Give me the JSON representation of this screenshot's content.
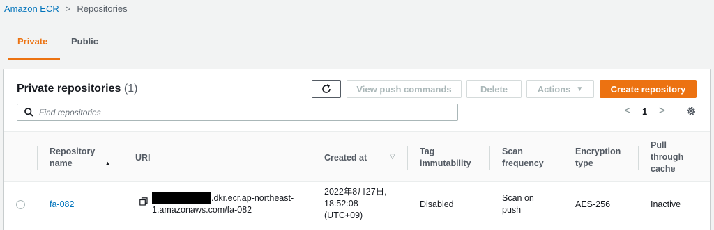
{
  "breadcrumb": {
    "root": "Amazon ECR",
    "separator": ">",
    "current": "Repositories"
  },
  "tabs": [
    {
      "label": "Private",
      "active": true
    },
    {
      "label": "Public",
      "active": false
    }
  ],
  "panel": {
    "title": "Private repositories",
    "count": "(1)"
  },
  "toolbar": {
    "refresh_icon": "refresh-icon",
    "view_push": "View push commands",
    "delete": "Delete",
    "actions": "Actions",
    "actions_caret": "▼",
    "create": "Create repository"
  },
  "search": {
    "placeholder": "Find repositories",
    "value": ""
  },
  "pagination": {
    "prev": "<",
    "page": "1",
    "next": ">"
  },
  "table": {
    "headers": {
      "name_line1": "Repository",
      "name_line2": "name",
      "uri": "URI",
      "created": "Created at",
      "tag_line1": "Tag",
      "tag_line2": "immutability",
      "scan_line1": "Scan",
      "scan_line2": "frequency",
      "enc_line1": "Encryption",
      "enc_line2": "type",
      "pull_line1": "Pull",
      "pull_line2": "through",
      "pull_line3": "cache",
      "sort_asc": "▲",
      "sort_desc": "▽"
    },
    "rows": [
      {
        "name": "fa-082",
        "uri_line1": ".dkr.ecr.ap-northeast-",
        "uri_line2": "1.amazonaws.com/fa-082",
        "created_line1": "2022年8月27日,",
        "created_line2": "18:52:08",
        "created_line3": "(UTC+09)",
        "tag": "Disabled",
        "scan_line1": "Scan on",
        "scan_line2": "push",
        "encryption": "AES-256",
        "pull_cache": "Inactive"
      }
    ]
  },
  "colors": {
    "accent": "#ec7211",
    "link": "#0073bb",
    "text": "#16191f",
    "muted": "#545b64"
  }
}
